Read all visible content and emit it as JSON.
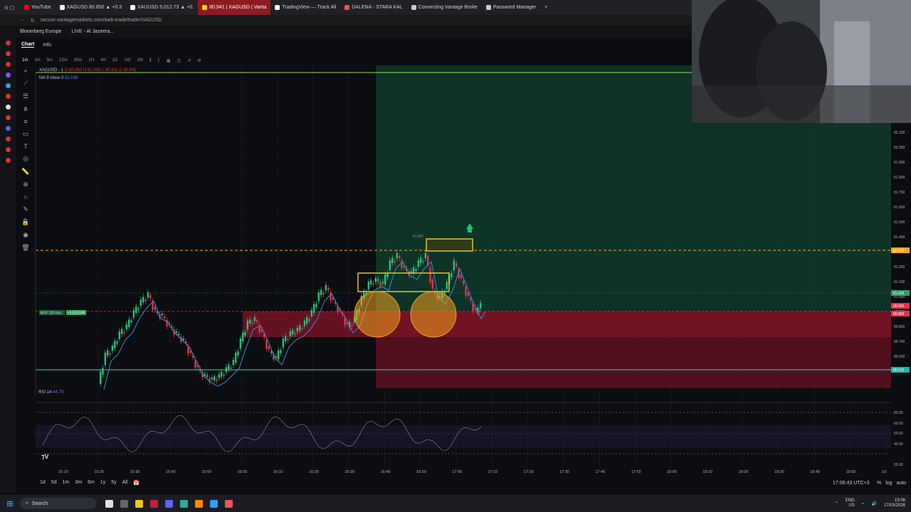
{
  "browser": {
    "tabs": [
      {
        "label": "YouTube",
        "color": "#ff0000"
      },
      {
        "label": "XAGUSD 80.850 ▲ +0.3",
        "color": "#ffffff"
      },
      {
        "label": "XAUUSD 5,012.73 ▲ +0.",
        "color": "#ffffff"
      },
      {
        "label": "80.941 | XAGUSD | Vanta",
        "color": "#ffffff",
        "active": true
      },
      {
        "label": "TradingView — Track All",
        "color": "#ffffff"
      },
      {
        "label": "DALENA - STARA KAL",
        "color": "#ff4d4d"
      },
      {
        "label": "Connecting Vantage Broke",
        "color": "#cccccc"
      },
      {
        "label": "Password Manager",
        "color": "#cccccc"
      }
    ],
    "new_tab": "+",
    "url": "secure.vantagemarkets.com/web-trade/trade/XAGUSD",
    "bookmarks": [
      "Bloomberg Europe",
      "LIVE - Al Jazeera..."
    ]
  },
  "chart_tabs": [
    "Chart",
    "Info"
  ],
  "intervals": [
    "1m",
    "3m",
    "5m",
    "15m",
    "30m",
    "1H",
    "4H",
    "1D",
    "1W",
    "1M"
  ],
  "legend": {
    "symbol": "XAGUSD · 1",
    "o": "O 80.862",
    "h": "H 81.003",
    "l": "L 80.911",
    "c": "C 80.942",
    "ma_label": "MA 9 close 0",
    "ma_value": "81.038",
    "rsi_label": "RSI 14",
    "rsi_value": "44.79",
    "high_marker": "81.347",
    "buy_label": "BUY 100 lots",
    "buy_pnl": "+1.63 EUR"
  },
  "price_axis": [
    "82.100",
    "82.000",
    "81.900",
    "81.800",
    "81.700",
    "81.600",
    "81.500",
    "81.400",
    "81.300",
    "81.200",
    "81.100",
    "81.000",
    "80.900",
    "80.800",
    "80.700",
    "80.600",
    "80.500"
  ],
  "price_tags": [
    {
      "label": "81.315",
      "color": "#f5a623"
    },
    {
      "label": "81.029",
      "color": "#2e9e6a"
    },
    {
      "label": "80.942",
      "color": "#e8334a"
    },
    {
      "label": "80.889",
      "color": "#e8334a"
    },
    {
      "label": "80.515",
      "color": "#22b3a6"
    }
  ],
  "rsi_axis": [
    "80.00",
    "60.00",
    "50.00",
    "40.00",
    "20.00"
  ],
  "time_axis": [
    "15:10",
    "15:20",
    "15:30",
    "15:40",
    "15:50",
    "16:00",
    "16:10",
    "16:20",
    "16:30",
    "16:40",
    "16:50",
    "17:00",
    "17:10",
    "17:20",
    "17:30",
    "17:40",
    "17:50",
    "18:00",
    "18:10",
    "18:20",
    "18:30",
    "18:40",
    "18:50",
    "19:"
  ],
  "timeframes": [
    "1d",
    "5d",
    "1m",
    "3m",
    "6m",
    "1y",
    "5y",
    "All"
  ],
  "clock": "17:06:43 UTC+3",
  "axis_options": [
    "%",
    "log",
    "auto"
  ],
  "taskbar": {
    "search": "Search",
    "lang": "ENG",
    "region": "US",
    "time": "15:06",
    "date": "17/03/2026"
  },
  "colors": {
    "profit_zone": "#0f3b2c",
    "loss_zone": "#5c1020",
    "candle_up": "#26c281",
    "candle_down": "#e8334a",
    "entry_line": "#f5a623",
    "support_line": "#22b3a6",
    "highlight_box": "#e6c229",
    "circle": "#f3a01e"
  }
}
